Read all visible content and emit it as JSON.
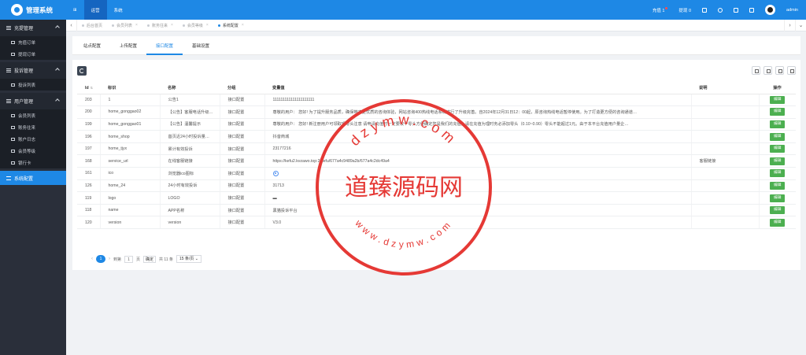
{
  "app": {
    "title": "管理系统"
  },
  "topbar": {
    "tabs": [
      {
        "label": "⊞",
        "active": false
      },
      {
        "label": "运营",
        "active": true
      },
      {
        "label": "系统",
        "active": false
      }
    ],
    "recharge_label": "充值 1",
    "withdraw_label": "提现 0",
    "user_name": "admin",
    "icons": [
      "flag-icon",
      "refresh-icon",
      "delete-icon",
      "fullscreen-icon"
    ]
  },
  "sidebar": {
    "groups": [
      {
        "label": "充提管理",
        "items": [
          "充值订单",
          "提现订单"
        ]
      },
      {
        "label": "投诉管理",
        "items": [
          "投诉列表"
        ]
      },
      {
        "label": "用户管理",
        "items": [
          "会员列表",
          "账务往来",
          "账户日志",
          "会员等级",
          "银行卡"
        ]
      }
    ],
    "active_item": "系统配置"
  },
  "page_tabs": [
    {
      "label": "后台首页",
      "active": false
    },
    {
      "label": "会员列表",
      "active": false
    },
    {
      "label": "账务往来",
      "active": false
    },
    {
      "label": "会员等级",
      "active": false
    },
    {
      "label": "系统配置",
      "active": true
    }
  ],
  "config_tabs": [
    {
      "label": "站点配置",
      "active": false
    },
    {
      "label": "上传配置",
      "active": false
    },
    {
      "label": "接口配置",
      "active": true
    },
    {
      "label": "基础设置",
      "active": false
    }
  ],
  "table": {
    "columns": [
      "Id",
      "标识",
      "名称",
      "分组",
      "变量值",
      "说明",
      "操作"
    ],
    "edit_label": "编辑",
    "rows": [
      {
        "id": "203",
        "key": "1",
        "name": "公告1",
        "group": "接口配置",
        "value": "111111111111111111111",
        "note": ""
      },
      {
        "id": "200",
        "key": "home_gonggao02",
        "name": "【公告】客服电话升级…",
        "group": "接口配置",
        "value": "尊敬的用户：  您好! 为了提升服务品质，确保带来更优质的咨询体验，网站咨询400热线电话系统进行了升级完善。自2024年12月31日12：00起，原咨询热线电话暂停使用。为了打造更方便的咨询通道…",
        "note": ""
      },
      {
        "id": "199",
        "key": "home_gonggao01",
        "name": "【公告】温馨提示",
        "group": "接口配置",
        "value": "尊敬的用户：  您好! 新注册用户可领取现零头注意 请申请充值时一定要较个零头方便确定您是我们的充值。请在充值为理时务必添加零头（0.10~0.90）零头不能超过1元。由于本平台充值用户量企…",
        "note": ""
      },
      {
        "id": "196",
        "key": "home_shop",
        "name": "首页近24小时投诉量…",
        "group": "接口配置",
        "value": "抖音商城",
        "note": ""
      },
      {
        "id": "197",
        "key": "home_tjyx",
        "name": "累计有效投诉",
        "group": "接口配置",
        "value": "23177216",
        "note": ""
      },
      {
        "id": "168",
        "key": "service_url",
        "name": "在线客服链接",
        "group": "接口配置",
        "value": "https://kefu2.kvzawo.top:2/kefu/677a4c9489a2b/677a4c2dc49a4",
        "note": "客服链接"
      },
      {
        "id": "161",
        "key": "ico",
        "name": "浏览器ico图标",
        "group": "接口配置",
        "value": "",
        "note": ""
      },
      {
        "id": "126",
        "key": "home_24",
        "name": "24小时有效投诉",
        "group": "接口配置",
        "value": "31713",
        "note": ""
      },
      {
        "id": "119",
        "key": "logo",
        "name": "LOGO",
        "group": "接口配置",
        "value": "▬",
        "note": ""
      },
      {
        "id": "118",
        "key": "name",
        "name": "APP名称",
        "group": "接口配置",
        "value": "黑猫投诉平台",
        "note": ""
      },
      {
        "id": "120",
        "key": "version",
        "name": "version",
        "group": "接口配置",
        "value": "V3.0",
        "note": ""
      }
    ]
  },
  "pager": {
    "current": "1",
    "goto_label": "到第",
    "page_input": "1",
    "page_unit": "页",
    "confirm_label": "确定",
    "total_label": "共 11 条",
    "page_size": "15 条/页"
  },
  "watermark": {
    "top_text": "dzymw.com",
    "center_text": "道臻源码网",
    "bottom_text": "www.dzymw.com",
    "color": "#e53935"
  }
}
